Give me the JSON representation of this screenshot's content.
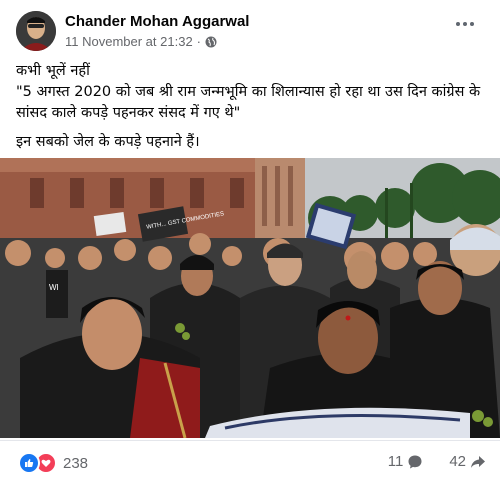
{
  "post": {
    "author": "Chander Mohan Aggarwal",
    "timestamp": "11 November at 21:32",
    "separator": "·",
    "privacy_icon": "globe-icon",
    "more_icon": "ellipsis-icon"
  },
  "text": {
    "line1": "कभी भूलें नहीं",
    "line2": "\"5 अगस्त 2020 को जब श्री राम जन्मभूमि का शिलान्यास हो रहा था उस दिन कांग्रेस के सांसद काले कपड़े पहनकर संसद में गए थे\"",
    "line3": "इन सबको जेल के कपड़े पहनाने हैं।"
  },
  "photo": {
    "placard": "WITH... GST COMMODITIES",
    "sign_left": "WI"
  },
  "footer": {
    "reaction_icons": [
      "like-icon",
      "love-icon"
    ],
    "reaction_count": "238",
    "comments_count": "11",
    "shares_count": "42"
  },
  "colors": {
    "accent": "#1877f2",
    "love": "#f33e58",
    "secondary_text": "#65676b"
  }
}
